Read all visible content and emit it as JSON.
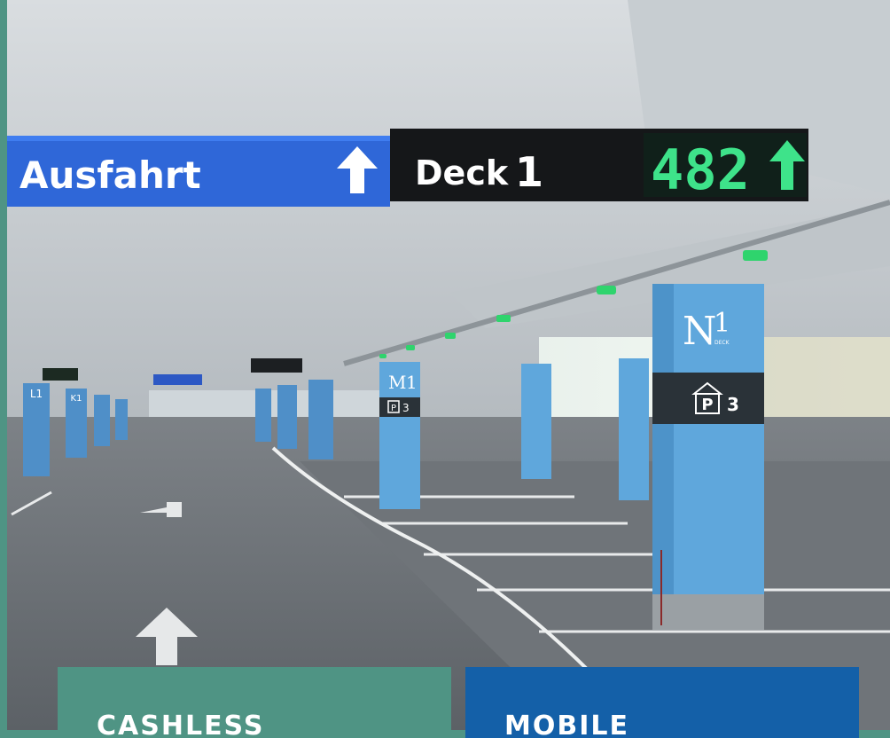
{
  "photo": {
    "exit_sign": {
      "label": "Ausfahrt"
    },
    "deck_sign": {
      "word": "Deck",
      "number": "1"
    },
    "counter": {
      "value": "482"
    },
    "pillars": {
      "n1": {
        "letter": "N",
        "number": "1",
        "small": "DECK",
        "parking": "P",
        "parking_no": "3"
      },
      "m1": {
        "letter": "M",
        "number": "1",
        "parking": "P",
        "parking_no": "3"
      },
      "l1": {
        "label": "L1"
      },
      "k1": {
        "label": "K1"
      }
    }
  },
  "cards": {
    "cashless": {
      "title": "CASHLESS"
    },
    "mobile": {
      "title": "MOBILE"
    }
  },
  "colors": {
    "frame": "#4f9484",
    "cashless_card": "#4f9484",
    "mobile_card": "#1460a8",
    "exit_sign_blue": "#2f67d8",
    "counter_green": "#3ee38a",
    "pillar_blue": "#5fa7dc"
  }
}
